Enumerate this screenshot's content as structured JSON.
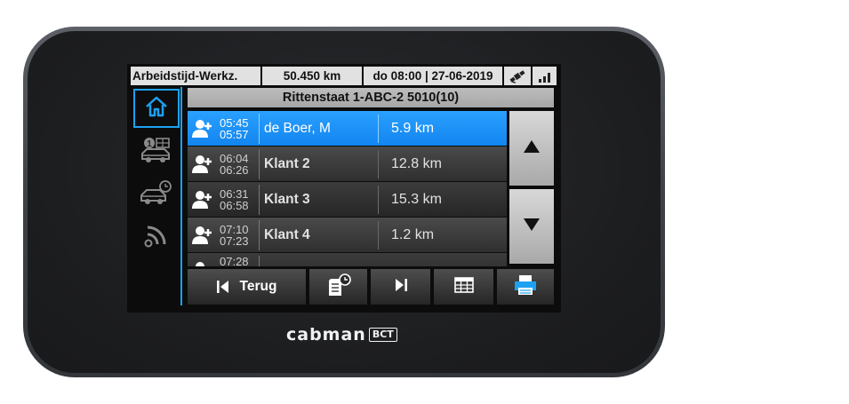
{
  "status_bar": {
    "mode": "Arbeidstijd-Werkz.",
    "odometer": "50.450 km",
    "datetime": "do 08:00 | 27-06-2019",
    "icons": [
      "gps-icon",
      "signal-strength-icon"
    ]
  },
  "sidebar": {
    "items": [
      {
        "icon": "home-icon",
        "active": true
      },
      {
        "icon": "taxi-meter-icon",
        "active": false
      },
      {
        "icon": "car-clock-icon",
        "active": false
      },
      {
        "icon": "wireless-icon",
        "active": false
      }
    ]
  },
  "title": "Rittenstaat 1-ABC-2 5010(10)",
  "trips": [
    {
      "start": "05:45",
      "end": "05:57",
      "name": "de Boer, M",
      "distance": "5.9 km",
      "selected": true
    },
    {
      "start": "06:04",
      "end": "06:26",
      "name": "Klant 2",
      "distance": "12.8 km",
      "selected": false
    },
    {
      "start": "06:31",
      "end": "06:58",
      "name": "Klant 3",
      "distance": "15.3 km",
      "selected": false
    },
    {
      "start": "07:10",
      "end": "07:23",
      "name": "Klant 4",
      "distance": "1.2 km",
      "selected": false
    },
    {
      "start": "07:28",
      "end": "",
      "name": "",
      "distance": "",
      "selected": false
    }
  ],
  "scroll": {
    "up_icon": "arrow-up-icon",
    "down_icon": "arrow-down-icon"
  },
  "bottom_bar": {
    "back_label": "Terug",
    "back_icon": "skip-back-icon",
    "buttons": [
      "document-clock-icon",
      "skip-forward-icon",
      "table-icon",
      "printer-icon"
    ]
  },
  "brand": {
    "name": "cabman",
    "badge": "BCT"
  },
  "colors": {
    "accent": "#1da1f2",
    "selected_row": "#1a90f5",
    "status_bar": "#e1e1e1"
  }
}
